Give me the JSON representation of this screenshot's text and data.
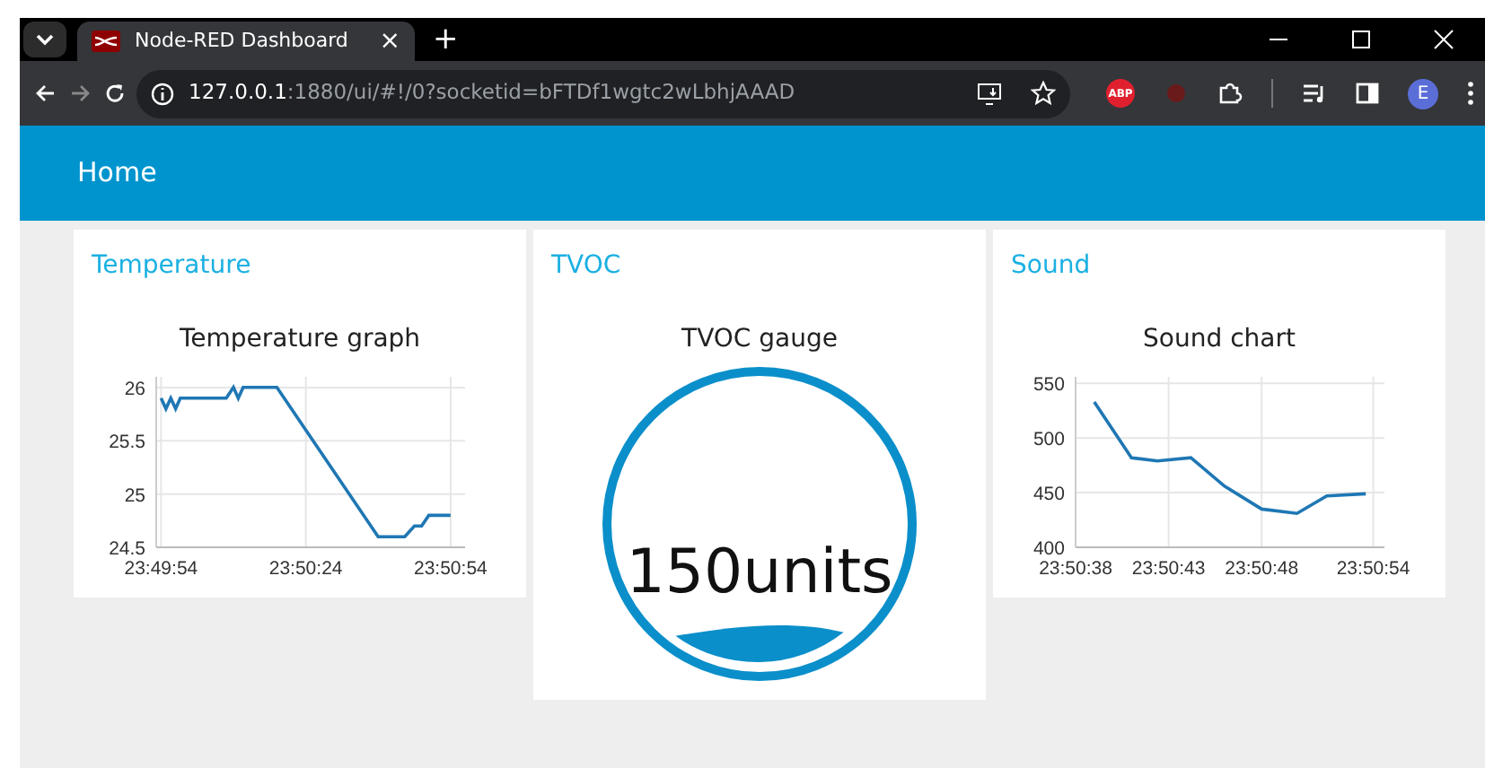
{
  "browser": {
    "tab": {
      "title": "Node-RED Dashboard",
      "close": "×",
      "selected": true
    },
    "new_tab": "+",
    "address": {
      "host": "127.0.0.1",
      "path": ":1880/ui/#!/0?socketid=bFTDf1wgtc2wLbhjAAAD"
    },
    "extension_badge": "ABP",
    "profile": "E"
  },
  "header": {
    "title": "Home"
  },
  "groups": [
    {
      "title": "Temperature",
      "kind": "chart",
      "widget_title": "Temperature graph",
      "chart_data": {
        "type": "line",
        "grid": true,
        "x": [
          85794,
          85795,
          85796,
          85797,
          85798,
          85807.5,
          85809,
          85810,
          85811,
          85818,
          85839,
          85844.5,
          85846.5,
          85848,
          85849.5,
          85854
        ],
        "series": [
          {
            "color": "#1f77b4",
            "values": [
              25.9,
              25.8,
              25.9,
              25.8,
              25.9,
              25.9,
              26,
              25.9,
              26,
              26,
              24.6,
              24.6,
              24.7,
              24.7,
              24.8,
              24.8
            ]
          }
        ],
        "xlim": [
          85793,
          85857
        ],
        "ylim": [
          24.5,
          26.1
        ],
        "xticks": [
          {
            "value": 85794,
            "label": "23:49:54"
          },
          {
            "value": 85824,
            "label": "23:50:24"
          },
          {
            "value": 85854,
            "label": "23:50:54"
          }
        ],
        "yticks": [
          {
            "value": 24.5,
            "label": "24.5"
          },
          {
            "value": 25,
            "label": "25"
          },
          {
            "value": 25.5,
            "label": "25.5"
          },
          {
            "value": 26,
            "label": "26"
          }
        ]
      }
    },
    {
      "title": "TVOC",
      "kind": "gauge",
      "widget_title": "TVOC gauge",
      "value": "150units"
    },
    {
      "title": "Sound",
      "kind": "chart",
      "widget_title": "Sound chart",
      "chart_data": {
        "type": "line",
        "grid": true,
        "x": [
          85839,
          85841,
          85842.4,
          85844.2,
          85846,
          85848,
          85849.9,
          85851.5,
          85853.6
        ],
        "series": [
          {
            "color": "#1f77b4",
            "values": [
              533,
              482,
              479,
              482,
              456,
              435,
              431,
              447,
              449
            ]
          }
        ],
        "xlim": [
          85838,
          85854.6
        ],
        "ylim": [
          400,
          556
        ],
        "xticks": [
          {
            "value": 85838,
            "label": "23:50:38"
          },
          {
            "value": 85843,
            "label": "23:50:43"
          },
          {
            "value": 85848,
            "label": "23:50:48"
          },
          {
            "value": 85854,
            "label": "23:50:54"
          }
        ],
        "yticks": [
          {
            "value": 400,
            "label": "400"
          },
          {
            "value": 450,
            "label": "450"
          },
          {
            "value": 500,
            "label": "500"
          },
          {
            "value": 550,
            "label": "550"
          }
        ]
      }
    }
  ]
}
